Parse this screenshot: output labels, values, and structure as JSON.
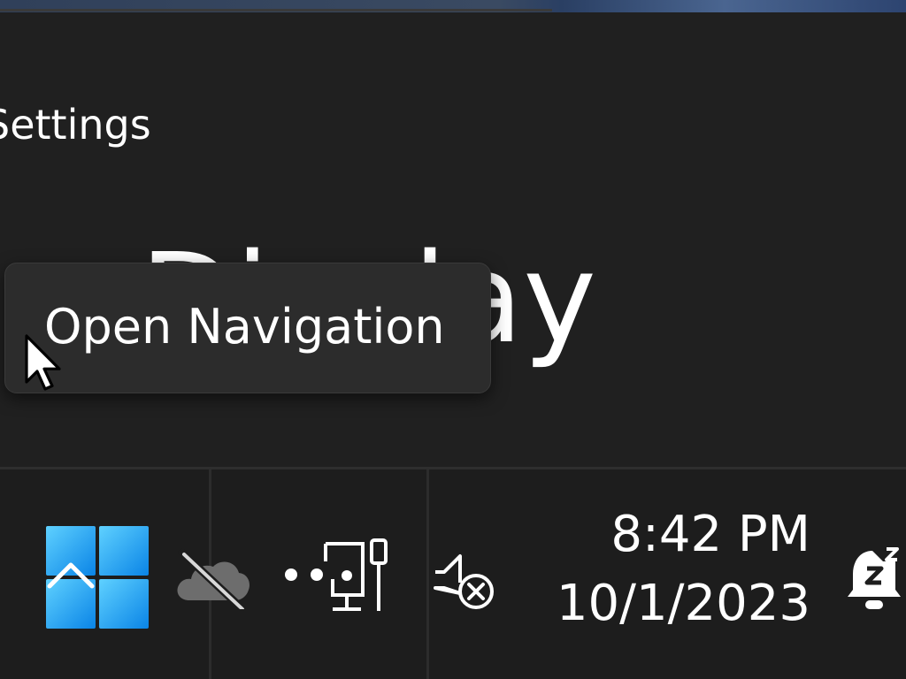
{
  "settings": {
    "app_title": "Settings",
    "page_title": "Display"
  },
  "tooltip": {
    "text": "Open Navigation"
  },
  "taskbar": {
    "start_icon": "windows-start-icon",
    "tray_icons": [
      "onedrive-offline-icon",
      "network-ethernet-icon",
      "volume-muted-icon",
      "notifications-snooze-icon"
    ],
    "clock": {
      "time": "8:42 PM",
      "date": "10/1/2023"
    }
  },
  "colors": {
    "window_bg": "#202020",
    "taskbar_bg": "#1d1d1d",
    "tooltip_bg": "#2c2c2c",
    "start_accent": "#1fa3ef",
    "text": "#ffffff"
  }
}
